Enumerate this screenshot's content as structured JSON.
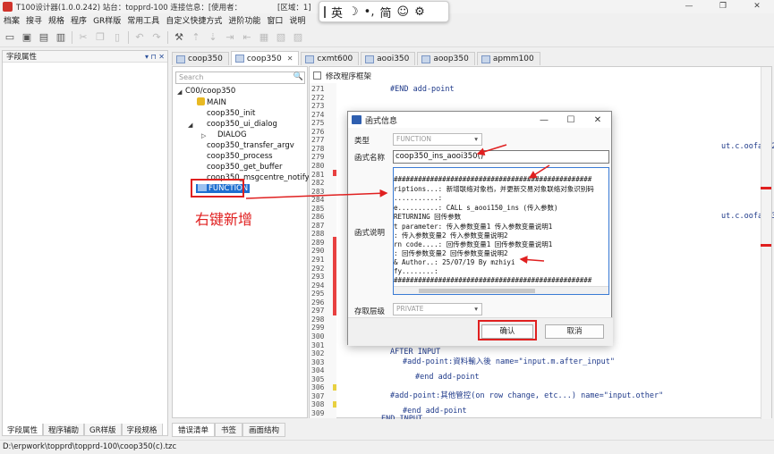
{
  "window": {
    "title": "T100设计器(1.0.0.242) 站台：topprd-100 连接信息：[使用者：",
    "region_label": "[区域：1]",
    "controls": [
      "—",
      "❐",
      "✕"
    ]
  },
  "ime": {
    "lang": "英",
    "moon": "☽",
    "punct": "•,",
    "charset": "简",
    "emoji": "☺",
    "settings": "⚙"
  },
  "menu": [
    "档案",
    "搜寻",
    "规格",
    "程序",
    "GR样版",
    "常用工具",
    "自定义快捷方式",
    "进阶功能",
    "窗口",
    "说明"
  ],
  "left_panel": {
    "title": "字段属性",
    "pin": "▾ ⊓ ✕",
    "tabs": [
      "字段属性",
      "程序辅助",
      "GR样版",
      "字段规格"
    ]
  },
  "editor_tabs": [
    {
      "label": "coop350",
      "active": false
    },
    {
      "label": "coop350",
      "active": true,
      "close": "✕"
    },
    {
      "label": "cxmt600",
      "active": false
    },
    {
      "label": "aooi350",
      "active": false
    },
    {
      "label": "aoop350",
      "active": false
    },
    {
      "label": "apmm100",
      "active": false
    }
  ],
  "outline": {
    "search_placeholder": "Search",
    "search_icon": "🔍",
    "nodes": [
      "C00/coop350",
      "MAIN",
      "coop350_init",
      "coop350_ui_dialog",
      "DIALOG",
      "coop350_transfer_argv",
      "coop350_process",
      "coop350_get_buffer",
      "coop350_msgcentre_notify",
      "FUNCTION"
    ],
    "annotation": "右键新增"
  },
  "editor": {
    "checkbox_label": "修改程序框架",
    "line_numbers": [
      "271",
      "272",
      "273",
      "274",
      "275",
      "276",
      "277",
      "278",
      "279",
      "280",
      "281",
      "282",
      "283",
      "284",
      "285",
      "286",
      "287",
      "288",
      "289",
      "290",
      "291",
      "292",
      "293",
      "294",
      "295",
      "296",
      "297",
      "298",
      "299",
      "300",
      "301",
      "302",
      "303",
      "304",
      "305",
      "306",
      "307",
      "308",
      "309"
    ],
    "code": {
      "l271": "#END add-point",
      "right1": "ut.c.oofa002\"",
      "right2": "ut.c.oofa003\"",
      "after_input": "AFTER INPUT",
      "add_point_after": "#add-point:資料輸入後 name=\"input.m.after_input\"",
      "end_add_point1": "#end add-point",
      "add_point_other": "#add-point:其他管控(on row change, etc...) name=\"input.other\"",
      "end_add_point2": "#end add-point",
      "end_input": "END INPUT"
    }
  },
  "bottom_tabs": [
    "错误清单",
    "书签",
    "画面结构"
  ],
  "status": "D:\\erpwork\\topprd\\topprd-100\\coop350(c).tzc",
  "dialog": {
    "title": "函式信息",
    "controls": [
      "—",
      "☐",
      "✕"
    ],
    "type_label": "类型",
    "type_value": "FUNCTION",
    "name_label": "函式名称",
    "name_value": "coop350_ins_aooi350()",
    "desc_label": "函式说明",
    "desc_lines": [
      "#################################################",
      "riptions...: 新增联络对象档，并更新交易对象联络对象识别码",
      "...........:",
      "e..........: CALL s_aooi150_ins (传入参数)",
      "             RETURNING 回传参数",
      "t parameter: 传入参数变量1   传入参数变量说明1",
      "           : 传入参数变量2   传入参数变量说明2",
      "rn code....: 回传参数变量1   回传参数变量说明1",
      "           : 回传参数变量2   回传参数变量说明2",
      "& Author..: 25/07/19 By mzhiyi",
      "fy........:",
      "#################################################"
    ],
    "level_label": "存取层级",
    "level_value": "PRIVATE",
    "ok": "确认",
    "cancel": "取消"
  },
  "annotation_color": "#e02020"
}
